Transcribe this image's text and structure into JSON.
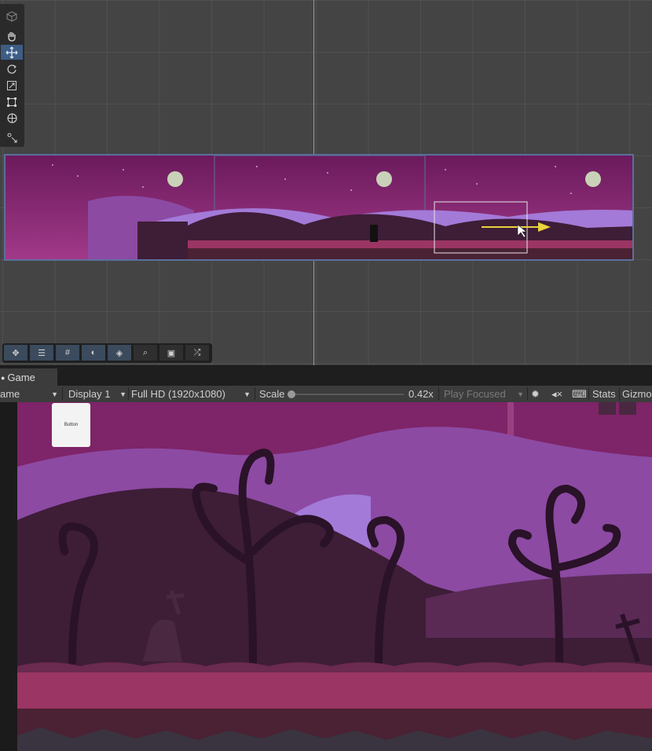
{
  "game_tab": {
    "label": "Game",
    "icon": "gamepad-icon"
  },
  "game_toolbar": {
    "game_dropdown": "ame",
    "display": "Display 1",
    "resolution": "Full HD (1920x1080)",
    "scale_label": "Scale",
    "scale_value": "0.42x",
    "play_mode": "Play Focused",
    "stats": "Stats",
    "gizmos": "Gizmo"
  },
  "scene_tools": [
    "view-cube-icon",
    "hand-tool-icon",
    "move-tool-icon",
    "rotate-tool-icon",
    "scale-tool-icon",
    "rect-tool-icon",
    "transform-tool-icon",
    "custom-tool-icon"
  ],
  "overlay_tools": [
    "move-overlay-icon",
    "sliders-icon",
    "grid-icon",
    "shading-icon",
    "layers-icon",
    "search-icon",
    "camera-icon",
    "shuffle-icon"
  ],
  "game_view": {
    "button_label": "Button"
  },
  "colors": {
    "sky": "#7e2468",
    "hill_far": "#8c4aa3",
    "hill_light": "#a37ad8",
    "hill_dark": "#3e1d37",
    "ground_pink": "#9b3563",
    "ground_dark": "#4a2233",
    "accent_blue": "#3d5d85",
    "arrow_yellow": "#e8d43c"
  }
}
